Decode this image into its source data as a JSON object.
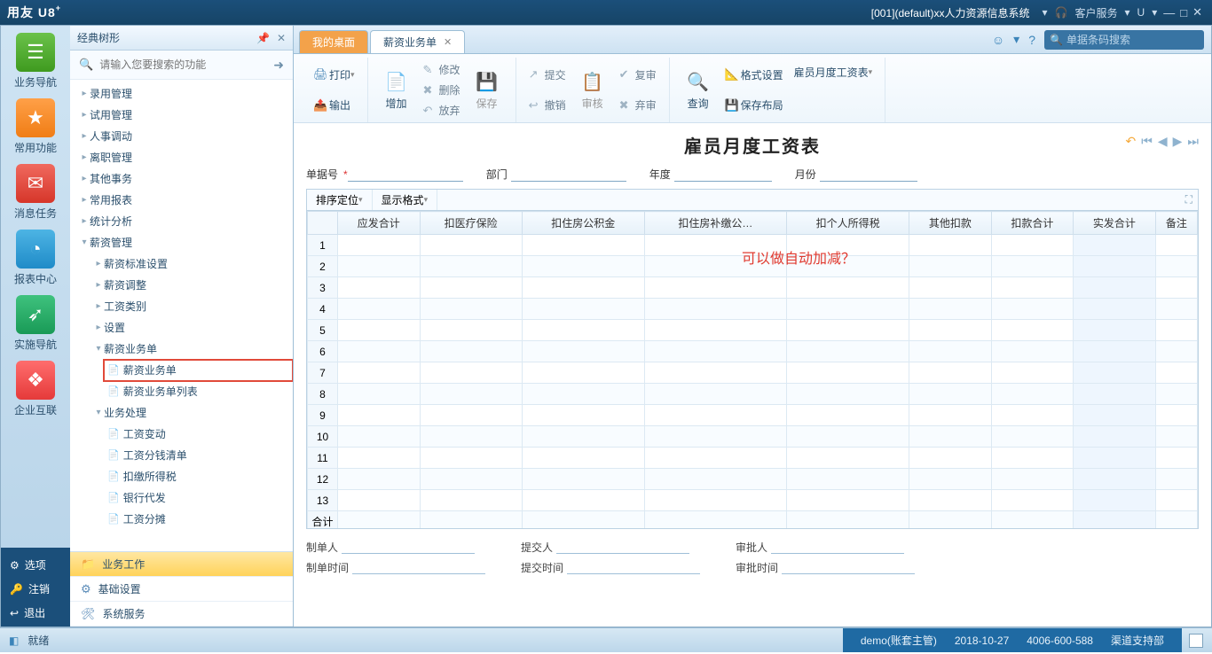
{
  "titlebar": {
    "brand": "用友 U8",
    "brand_sup": "+",
    "system_info": "[001](default)xx人力资源信息系统",
    "service": "客户服务",
    "u_menu": "U"
  },
  "navrail": {
    "items": [
      {
        "label": "业务导航",
        "cls": "ic-green",
        "glyph": "☰"
      },
      {
        "label": "常用功能",
        "cls": "ic-orange",
        "glyph": "★"
      },
      {
        "label": "消息任务",
        "cls": "ic-red",
        "glyph": "✉"
      },
      {
        "label": "报表中心",
        "cls": "ic-blue",
        "glyph": "◔"
      },
      {
        "label": "实施导航",
        "cls": "ic-green2",
        "glyph": "➶"
      },
      {
        "label": "企业互联",
        "cls": "ic-pink",
        "glyph": "❖"
      }
    ],
    "bottom": [
      {
        "label": "选项",
        "glyph": "⚙"
      },
      {
        "label": "注销",
        "glyph": "🔑"
      },
      {
        "label": "退出",
        "glyph": "↩"
      }
    ]
  },
  "treepanel": {
    "title": "经典树形",
    "search_placeholder": "请输入您要搜索的功能",
    "nodes_top": [
      "录用管理",
      "试用管理",
      "人事调动",
      "离职管理",
      "其他事务",
      "常用报表",
      "统计分析"
    ],
    "salary_root": "薪资管理",
    "salary_children": [
      "薪资标准设置",
      "薪资调整",
      "工资类别",
      "设置"
    ],
    "biz_form": "薪资业务单",
    "biz_form_children": [
      "薪资业务单",
      "薪资业务单列表"
    ],
    "biz_proc": "业务处理",
    "biz_proc_children": [
      "工资变动",
      "工资分钱清单",
      "扣缴所得税",
      "银行代发",
      "工资分摊"
    ],
    "bottom_tabs": [
      "业务工作",
      "基础设置",
      "系统服务"
    ]
  },
  "tabs": {
    "t1": "我的桌面",
    "t2": "薪资业务单"
  },
  "topsearch_placeholder": "单据条码搜索",
  "ribbon": {
    "print": "打印",
    "output": "输出",
    "add": "增加",
    "modify": "修改",
    "delete": "删除",
    "discard": "放弃",
    "save": "保存",
    "submit": "提交",
    "revoke": "撤销",
    "audit": "审核",
    "review": "复审",
    "unreview": "弃审",
    "query": "查询",
    "format": "格式设置",
    "save_layout": "保存布局",
    "template": "雇员月度工资表"
  },
  "doc": {
    "title": "雇员月度工资表",
    "fields": {
      "docno": "单据号",
      "dept": "部门",
      "year": "年度",
      "month": "月份"
    },
    "sort": "排序定位",
    "dispfmt": "显示格式"
  },
  "grid": {
    "cols": [
      "应发合计",
      "扣医疗保险",
      "扣住房公积金",
      "扣住房补缴公…",
      "扣个人所得税",
      "其他扣款",
      "扣款合计",
      "实发合计",
      "备注"
    ],
    "rows": 13,
    "total_label": "合计"
  },
  "annotation": "可以做自动加减？",
  "docfoot": {
    "maker": "制单人",
    "make_time": "制单时间",
    "submitter": "提交人",
    "submit_time": "提交时间",
    "approver": "审批人",
    "approve_time": "审批时间"
  },
  "status": {
    "ready": "就绪",
    "user": "demo(账套主管)",
    "date": "2018-10-27",
    "phone": "4006-600-588",
    "dept": "渠道支持部"
  }
}
